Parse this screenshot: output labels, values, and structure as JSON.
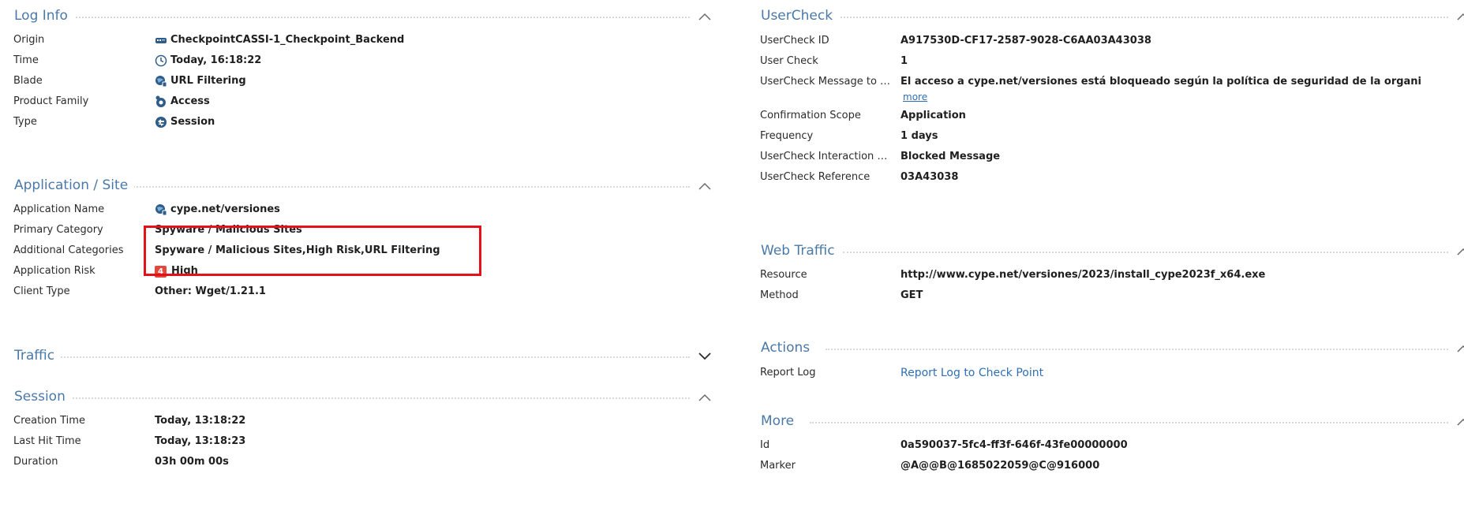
{
  "left": {
    "log_info": {
      "title": "Log Info",
      "rows": [
        {
          "label": "Origin",
          "value": "CheckpointCASSI-1_Checkpoint_Backend"
        },
        {
          "label": "Time",
          "value": "Today, 16:18:22"
        },
        {
          "label": "Blade",
          "value": "URL Filtering"
        },
        {
          "label": "Product Family",
          "value": "Access"
        },
        {
          "label": "Type",
          "value": "Session"
        }
      ]
    },
    "application_site": {
      "title": "Application / Site",
      "rows": [
        {
          "label": "Application Name",
          "value": "cype.net/versiones"
        },
        {
          "label": "Primary Category",
          "value": "Spyware / Malicious Sites"
        },
        {
          "label": "Additional Categories",
          "value": "Spyware / Malicious Sites,High Risk,URL Filtering"
        },
        {
          "label": "Application Risk",
          "value": "High",
          "badge": "4"
        },
        {
          "label": "Client Type",
          "value": "Other: Wget/1.21.1"
        }
      ]
    },
    "traffic": {
      "title": "Traffic"
    },
    "session": {
      "title": "Session",
      "rows": [
        {
          "label": "Creation Time",
          "value": "Today, 13:18:22"
        },
        {
          "label": "Last Hit Time",
          "value": "Today, 13:18:23"
        },
        {
          "label": "Duration",
          "value": "03h 00m 00s"
        }
      ]
    }
  },
  "right": {
    "usercheck": {
      "title": "UserCheck",
      "rows": [
        {
          "label": "UserCheck ID",
          "value": "A917530D-CF17-2587-9028-C6AA03A43038"
        },
        {
          "label": "User Check",
          "value": "1"
        },
        {
          "label": "UserCheck Message to Us...",
          "value": "El acceso a cype.net/versiones está bloqueado según la política de seguridad de la organización. Para o..."
        },
        {
          "label": "Confirmation Scope",
          "value": "Application"
        },
        {
          "label": "Frequency",
          "value": "1 days"
        },
        {
          "label": "UserCheck Interaction Na...",
          "value": "Blocked Message"
        },
        {
          "label": "UserCheck Reference",
          "value": "03A43038"
        }
      ],
      "more_link": "more"
    },
    "web_traffic": {
      "title": "Web Traffic",
      "rows": [
        {
          "label": "Resource",
          "value": "http://www.cype.net/versiones/2023/install_cype2023f_x64.exe"
        },
        {
          "label": "Method",
          "value": "GET"
        }
      ]
    },
    "actions": {
      "title": "Actions",
      "rows": [
        {
          "label": "Report Log",
          "value": "Report Log to Check Point"
        }
      ]
    },
    "more": {
      "title": "More",
      "rows": [
        {
          "label": "Id",
          "value": "0a590037-5fc4-ff3f-646f-43fe00000000"
        },
        {
          "label": "Marker",
          "value": "@A@@B@1685022059@C@916000"
        }
      ]
    }
  },
  "colors": {
    "section_title": "#4a79a8",
    "link": "#2f6fb5",
    "highlight": "#e3121a",
    "risk_badge": "#e2493d"
  }
}
